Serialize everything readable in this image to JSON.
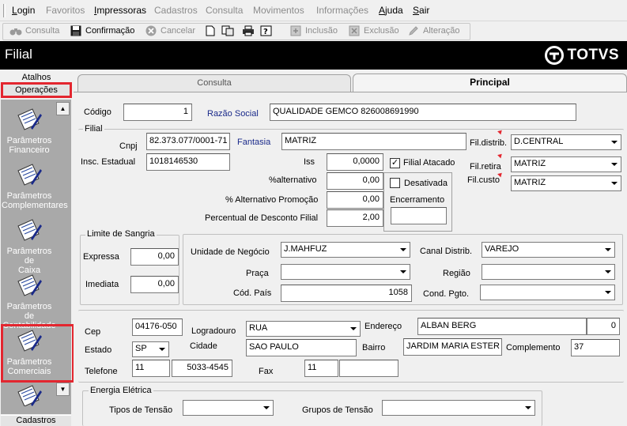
{
  "menu": {
    "items": [
      {
        "label": "Login",
        "enabled": true
      },
      {
        "label": "Favoritos",
        "enabled": false
      },
      {
        "label": "Impressoras",
        "enabled": true
      },
      {
        "label": "Cadastros",
        "enabled": false
      },
      {
        "label": "Consulta",
        "enabled": false
      },
      {
        "label": "Movimentos",
        "enabled": false
      },
      {
        "label": "Informações",
        "enabled": false
      },
      {
        "label": "Ajuda",
        "enabled": true
      },
      {
        "label": "Sair",
        "enabled": true
      }
    ]
  },
  "toolbar": {
    "consulta": "Consulta",
    "confirmacao": "Confirmação",
    "cancelar": "Cancelar",
    "inclusao": "Inclusão",
    "exclusao": "Exclusão",
    "alteracao": "Alteração"
  },
  "window": {
    "title": "Filial",
    "brand": "TOTVS"
  },
  "sidebar": {
    "atalhos": "Atalhos",
    "operacoes": "Operações",
    "cadastros": "Cadastros",
    "shortcuts": [
      {
        "line1": "Parâmetros",
        "line2": "Financeiro"
      },
      {
        "line1": "Parâmetros",
        "line2": "Complementares"
      },
      {
        "line1": "Parâmetros de",
        "line2": "Caixa"
      },
      {
        "line1": "Parâmetros de",
        "line2": "Contabilidade"
      },
      {
        "line1": "Parâmetros",
        "line2": "Comerciais"
      }
    ]
  },
  "tabs": {
    "consulta": "Consulta",
    "principal": "Principal"
  },
  "form": {
    "codigo_label": "Código",
    "codigo_value": "1",
    "razao_label": "Razão Social",
    "razao_value": "QUALIDADE GEMCO 826008691990",
    "filial_group": "Filial",
    "cnpj_label": "Cnpj",
    "cnpj_value": "82.373.077/0001-71",
    "fantasia_label": "Fantasia",
    "fantasia_value": "MATRIZ",
    "fil_distrib_label": "Fil.distrib.",
    "fil_distrib_value": "D.CENTRAL",
    "insc_label": "Insc. Estadual",
    "insc_value": "1018146530",
    "iss_label": "Iss",
    "iss_value": "0,0000",
    "filial_atacado_label": "Filial Atacado",
    "filial_atacado_checked": "✓",
    "fil_retira_label": "Fil.retira",
    "fil_retira_value": "MATRIZ",
    "alternativo_label": "%alternativo",
    "alternativo_value": "0,00",
    "desativada_label": "Desativada",
    "fil_custo_label": "Fil.custo",
    "fil_custo_value": "MATRIZ",
    "alt_promocao_label": "% Alternativo Promoção",
    "alt_promocao_value": "0,00",
    "encerramento_label": "Encerramento",
    "perc_desc_label": "Percentual de Desconto Filial",
    "perc_desc_value": "2,00",
    "sangria_group": "Limite de Sangria",
    "expressa_label": "Expressa",
    "expressa_value": "0,00",
    "imediata_label": "Imediata",
    "imediata_value": "0,00",
    "unidade_label": "Unidade de Negócio",
    "unidade_value": "J.MAHFUZ",
    "canal_label": "Canal Distrib.",
    "canal_value": "VAREJO",
    "praca_label": "Praça",
    "regiao_label": "Região",
    "cod_pais_label": "Cód. País",
    "cod_pais_value": "1058",
    "cond_pgto_label": "Cond. Pgto.",
    "cep_label": "Cep",
    "cep_value": "04176-050",
    "logradouro_label": "Logradouro",
    "logradouro_value": "RUA",
    "endereco_label": "Endereço",
    "endereco_value": "ALBAN BERG",
    "numero_value": "0",
    "estado_label": "Estado",
    "estado_value": "SP",
    "cidade_label": "Cidade",
    "cidade_value": "SAO PAULO",
    "bairro_label": "Bairro",
    "bairro_value": "JARDIM MARIA ESTER",
    "complemento_label": "Complemento",
    "complemento_value": "37",
    "telefone_label": "Telefone",
    "ddd_value": "11",
    "telefone_value": "5033-4545",
    "fax_label": "Fax",
    "fax_ddd_value": "11",
    "energia_group": "Energia Elétrica",
    "tipos_tensao_label": "Tipos de Tensão",
    "grupos_tensao_label": "Grupos de Tensão"
  }
}
